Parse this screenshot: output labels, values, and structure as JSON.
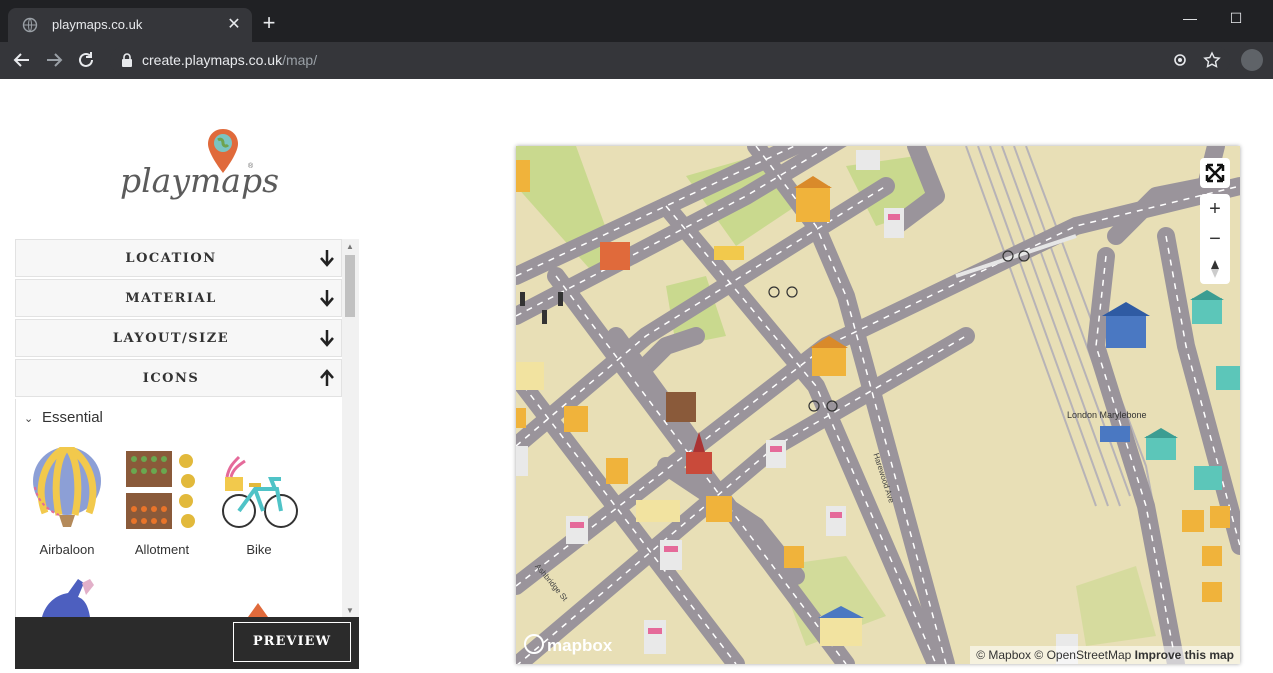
{
  "browser": {
    "tab_title": "playmaps.co.uk",
    "url_domain": "create.playmaps.co.uk",
    "url_path": "/map/"
  },
  "logo": {
    "text": "playmaps",
    "reg": "®"
  },
  "accordion": {
    "location": "LOCATION",
    "material": "MATERIAL",
    "layout": "LAYOUT/SIZE",
    "icons": "ICONS"
  },
  "icons_section": {
    "heading": "Essential",
    "items": [
      "Airbaloon",
      "Allotment",
      "Bike"
    ]
  },
  "footer": {
    "preview_label": "PREVIEW"
  },
  "map": {
    "attribution_mapbox": "© Mapbox",
    "attribution_osm": "© OpenStreetMap",
    "improve": "Improve this map",
    "logo": "mapbox",
    "labels": {
      "station": "London Marylebone",
      "street1": "Harewood Ave",
      "street2": "Ashbridge St"
    }
  },
  "colors": {
    "road": "#9a949b",
    "land": "#e8dfb6",
    "park": "#c9d98e",
    "dark": "#2b2b2b",
    "pin": "#e06a3b"
  }
}
